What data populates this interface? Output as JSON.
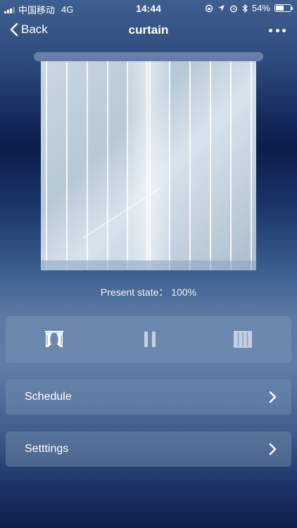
{
  "status_bar": {
    "carrier": "中国移动",
    "network": "4G",
    "time": "14:44",
    "battery_percent": "54%",
    "battery_level": 0.54
  },
  "nav": {
    "back_label": "Back",
    "title": "curtain",
    "more_icon": "ellipsis-icon"
  },
  "device": {
    "present_state": "Present state：  100%"
  },
  "controls": {
    "open_icon": "curtain-open-icon",
    "pause_icon": "pause-icon",
    "close_icon": "curtain-close-icon"
  },
  "menu": {
    "schedule_label": "Schedule",
    "settings_label": "Setttings"
  },
  "colors": {
    "background_top": "#3f5f8f",
    "background_dark": "#0b1d4a",
    "panel": "#7891b4"
  }
}
